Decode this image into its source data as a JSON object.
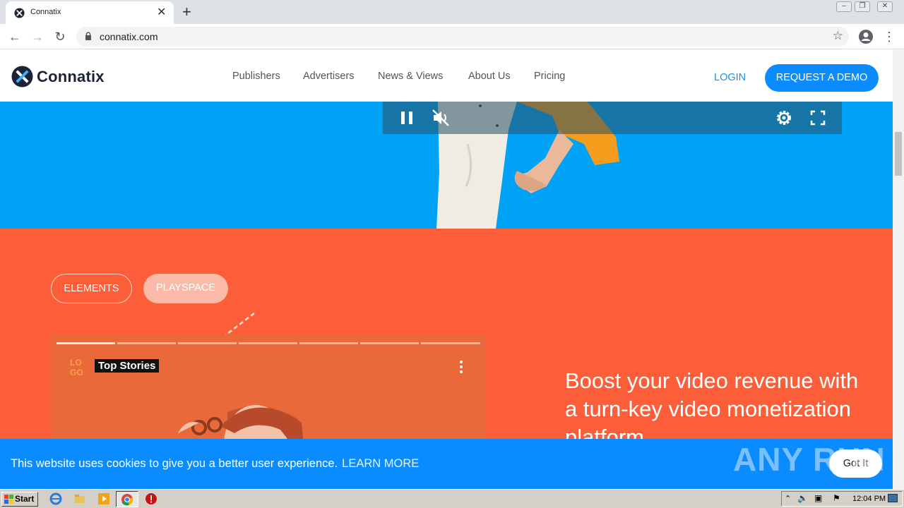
{
  "browser": {
    "tab_title": "Connatix",
    "new_tab": "+",
    "tab_close": "✕",
    "url": "connatix.com"
  },
  "site": {
    "brand": "Connatix",
    "nav": [
      "Publishers",
      "Advertisers",
      "News & Views",
      "About Us",
      "Pricing"
    ],
    "login": "LOGIN",
    "request_demo": "REQUEST A DEMO"
  },
  "section": {
    "pill_elements": "ELEMENTS",
    "pill_playspace": "PLAYSPACE",
    "story_title": "Top Stories",
    "story_logo": "LOGO",
    "headline": "Boost your video revenue with a turn-key video monetization platform"
  },
  "cookie": {
    "message": "This website uses cookies to give you a better user experience.",
    "learn_more": "LEARN MORE",
    "got_it": "Got It"
  },
  "watermark": "ANY RUN",
  "taskbar": {
    "start": "Start",
    "clock": "12:04 PM"
  },
  "colors": {
    "hero_blue": "#00a2f5",
    "section_orange": "#fd5e3a",
    "accent_blue": "#0a8cff",
    "cookie_blue": "#0a8cff"
  }
}
